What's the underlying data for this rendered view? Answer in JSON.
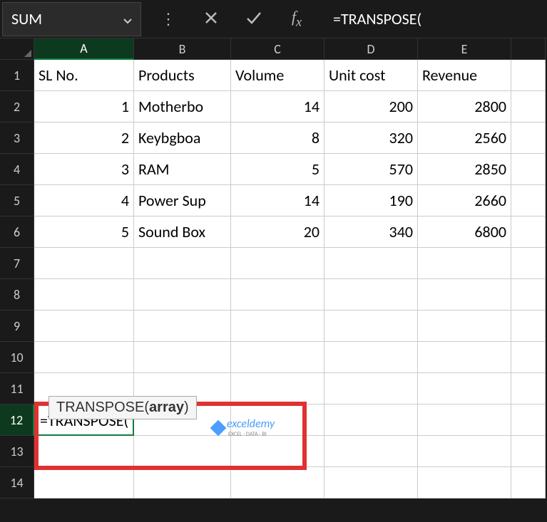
{
  "nameBox": {
    "value": "SUM"
  },
  "formulaBar": {
    "value": "=TRANSPOSE("
  },
  "columns": [
    "A",
    "B",
    "C",
    "D",
    "E"
  ],
  "activeColumn": "A",
  "activeRow": 12,
  "rows": [
    1,
    2,
    3,
    4,
    5,
    6,
    7,
    8,
    9,
    10,
    11,
    12,
    13,
    14
  ],
  "cells": {
    "A1": "SL No.",
    "B1": "Products",
    "C1": "Volume",
    "D1": "Unit cost",
    "E1": "Revenue",
    "A2": "1",
    "B2": "Motherbo",
    "C2": "14",
    "D2": "200",
    "E2": "2800",
    "A3": "2",
    "B3": "Keybgboa",
    "C3": "8",
    "D3": "320",
    "E3": "2560",
    "A4": "3",
    "B4": "RAM",
    "C4": "5",
    "D4": "570",
    "E4": "2850",
    "A5": "4",
    "B5": "Power Sup",
    "C5": "14",
    "D5": "190",
    "E5": "2660",
    "A6": "5",
    "B6": "Sound Box",
    "C6": "20",
    "D6": "340",
    "E6": "6800",
    "A12": "=TRANSPOSE("
  },
  "tooltip": {
    "func": "TRANSPOSE(",
    "arg": "array",
    "close": ")"
  },
  "watermark": {
    "text": "exceldemy",
    "subtitle": "EXCEL · DATA · BI"
  }
}
